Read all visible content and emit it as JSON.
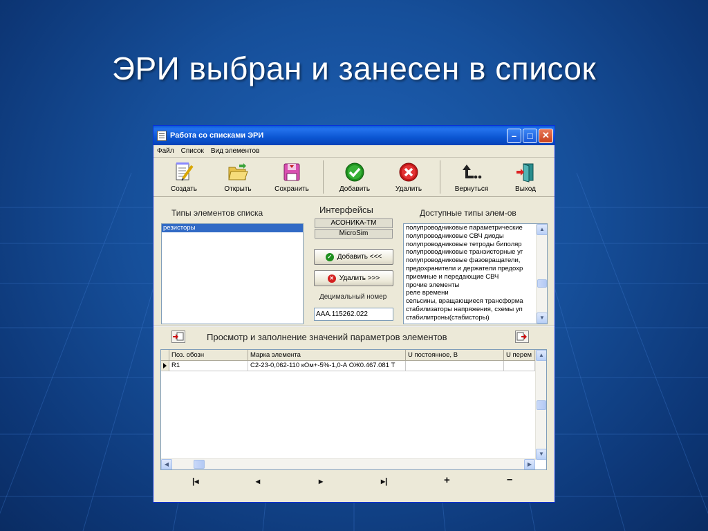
{
  "slide": {
    "title": "ЭРИ выбран и занесен в список"
  },
  "window": {
    "title": "Работа со списками ЭРИ",
    "menu": [
      "Файл",
      "Список",
      "Вид элементов"
    ],
    "toolbar": [
      {
        "label": "Создать",
        "icon": "notepad-pencil-icon"
      },
      {
        "label": "Открыть",
        "icon": "open-folder-icon"
      },
      {
        "label": "Сохранить",
        "icon": "floppy-disk-icon"
      },
      {
        "label": "Добавить",
        "icon": "green-check-icon"
      },
      {
        "label": "Удалить",
        "icon": "red-x-icon"
      },
      {
        "label": "Вернуться",
        "icon": "return-arrow-icon"
      },
      {
        "label": "Выход",
        "icon": "exit-door-icon"
      }
    ]
  },
  "types_panel": {
    "label": "Типы элементов списка",
    "items": [
      "резисторы"
    ]
  },
  "interfaces": {
    "label": "Интерфейсы",
    "items": [
      "АСОНИКА-ТМ",
      "MicroSim"
    ],
    "add_label": "Добавить <<<",
    "remove_label": "Удалить >>>",
    "decimal_label": "Децимальный номер",
    "decimal_value": "ААА.115262.022"
  },
  "available": {
    "label": "Доступные типы элем-ов",
    "items": [
      "полупроводниковые параметрические",
      "полупроводниковые СВЧ диоды",
      "полупроводниковые тетроды биполяр",
      "полупроводниковые транзисторные уг",
      "полупроводниковые фазовращатели,",
      "предохранители и держатели предохр",
      "приемные и передающие СВЧ",
      "прочие элементы",
      "реле времени",
      "сельсины, вращающиеся трансформа",
      "стабилизаторы напряжения, схемы уп",
      "стабилитроны(стабисторы)"
    ]
  },
  "params": {
    "label": "Просмотр и заполнение значений параметров элементов",
    "columns": [
      "Поз. обозн",
      "Марка элемента",
      "U постоянное, В",
      "U перем"
    ],
    "rows": [
      [
        "R1",
        "С2-23-0,062-110 кОм+-5%-1,0-А ОЖ0.467.081 Т",
        "",
        ""
      ]
    ]
  },
  "nav": [
    "|◂",
    "◂",
    "▸",
    "▸|",
    "+",
    "–"
  ],
  "colors": {
    "selection": "#316ac5",
    "titlebar": "#0b56d2",
    "slide_bg": "#164f9a"
  }
}
